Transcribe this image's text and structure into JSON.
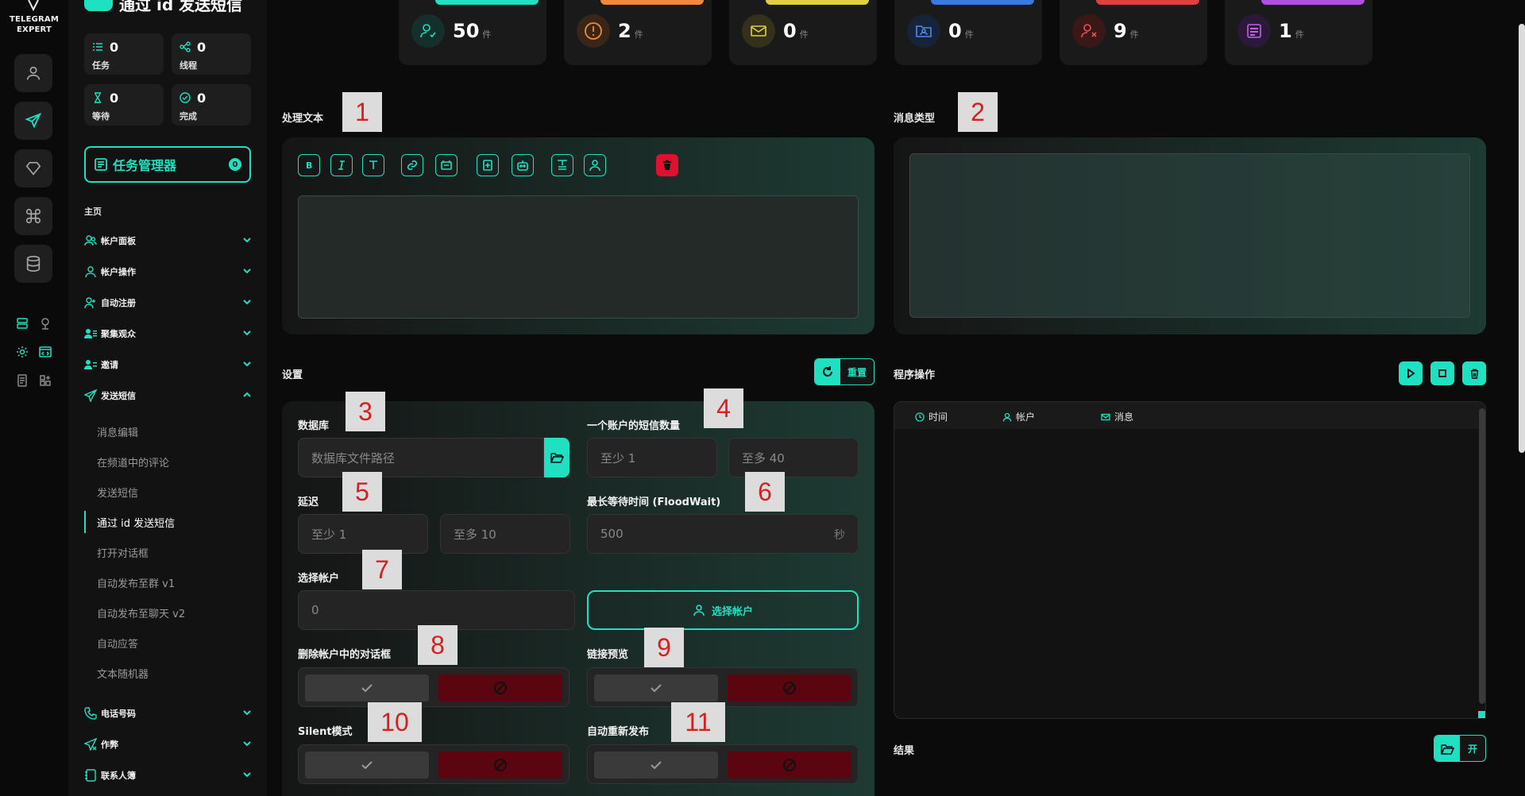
{
  "app": {
    "logo_text": "TELEGRAM EXPERT",
    "page_title": "通过 id 发送短信"
  },
  "sidebar_stats": [
    {
      "label": "任务",
      "value": "0",
      "icon": "tasks-icon"
    },
    {
      "label": "线程",
      "value": "0",
      "icon": "threads-icon"
    },
    {
      "label": "等待",
      "value": "0",
      "icon": "hourglass-icon"
    },
    {
      "label": "完成",
      "value": "0",
      "icon": "check-circle-icon"
    }
  ],
  "task_manager": {
    "label": "任务管理器",
    "badge": "0"
  },
  "nav": {
    "home_label": "主页",
    "items": [
      {
        "label": "帐户面板",
        "icon": "users-icon"
      },
      {
        "label": "帐户操作",
        "icon": "user-icon"
      },
      {
        "label": "自动注册",
        "icon": "user-plus-icon"
      },
      {
        "label": "聚集观众",
        "icon": "audience-icon"
      },
      {
        "label": "邀请",
        "icon": "invite-icon"
      },
      {
        "label": "发送短信",
        "icon": "send-icon"
      }
    ],
    "send_sub_items": [
      "消息编辑",
      "在频道中的评论",
      "发送短信",
      "通过 id 发送短信",
      "打开对话框",
      "自动发布至群 v1",
      "自动发布至聊天 v2",
      "自动应答",
      "文本随机器"
    ],
    "active_sub_index": 3,
    "bottom_items": [
      {
        "label": "电话号码",
        "icon": "phone-icon"
      },
      {
        "label": "作弊",
        "icon": "cheat-icon"
      },
      {
        "label": "联系人簿",
        "icon": "contacts-icon"
      }
    ]
  },
  "top_stats": [
    {
      "value": "50",
      "unit": "件",
      "color": "#1fe0c0",
      "icon": "user-check-icon"
    },
    {
      "value": "2",
      "unit": "件",
      "color": "#f08a3a",
      "icon": "warning-icon"
    },
    {
      "value": "0",
      "unit": "件",
      "color": "#e0d040",
      "icon": "mail-icon"
    },
    {
      "value": "0",
      "unit": "件",
      "color": "#3a7ae0",
      "icon": "folder-user-icon"
    },
    {
      "value": "9",
      "unit": "件",
      "color": "#e04040",
      "icon": "user-x-icon"
    },
    {
      "value": "1",
      "unit": "件",
      "color": "#b050e0",
      "icon": "checklist-icon"
    }
  ],
  "process_text": {
    "title": "处理文本"
  },
  "message_type": {
    "title": "消息类型"
  },
  "settings": {
    "title": "设置",
    "reset_label": "重置",
    "database_label": "数据库",
    "database_placeholder": "数据库文件路径",
    "sms_per_account_label": "一个账户的短信数量",
    "sms_min": "至少  1",
    "sms_max": "至多  40",
    "delay_label": "延迟",
    "delay_min": "至少  1",
    "delay_max": "至多  10",
    "floodwait_label": "最长等待时间 (FloodWait)",
    "floodwait_value": "500",
    "floodwait_unit": "秒",
    "select_accounts_label": "选择帐户",
    "select_accounts_value": "0",
    "select_accounts_button": "选择帐户",
    "delete_dialogs_label": "删除帐户中的对话框",
    "link_preview_label": "链接预览",
    "silent_label": "Silent模式",
    "auto_repost_label": "自动重新发布"
  },
  "program_ops": {
    "title": "程序操作",
    "columns": [
      "时间",
      "帐户",
      "消息"
    ]
  },
  "results": {
    "title": "结果",
    "open_label": "开"
  },
  "markers": [
    "1",
    "2",
    "3",
    "4",
    "5",
    "6",
    "7",
    "8",
    "9",
    "10",
    "11"
  ]
}
